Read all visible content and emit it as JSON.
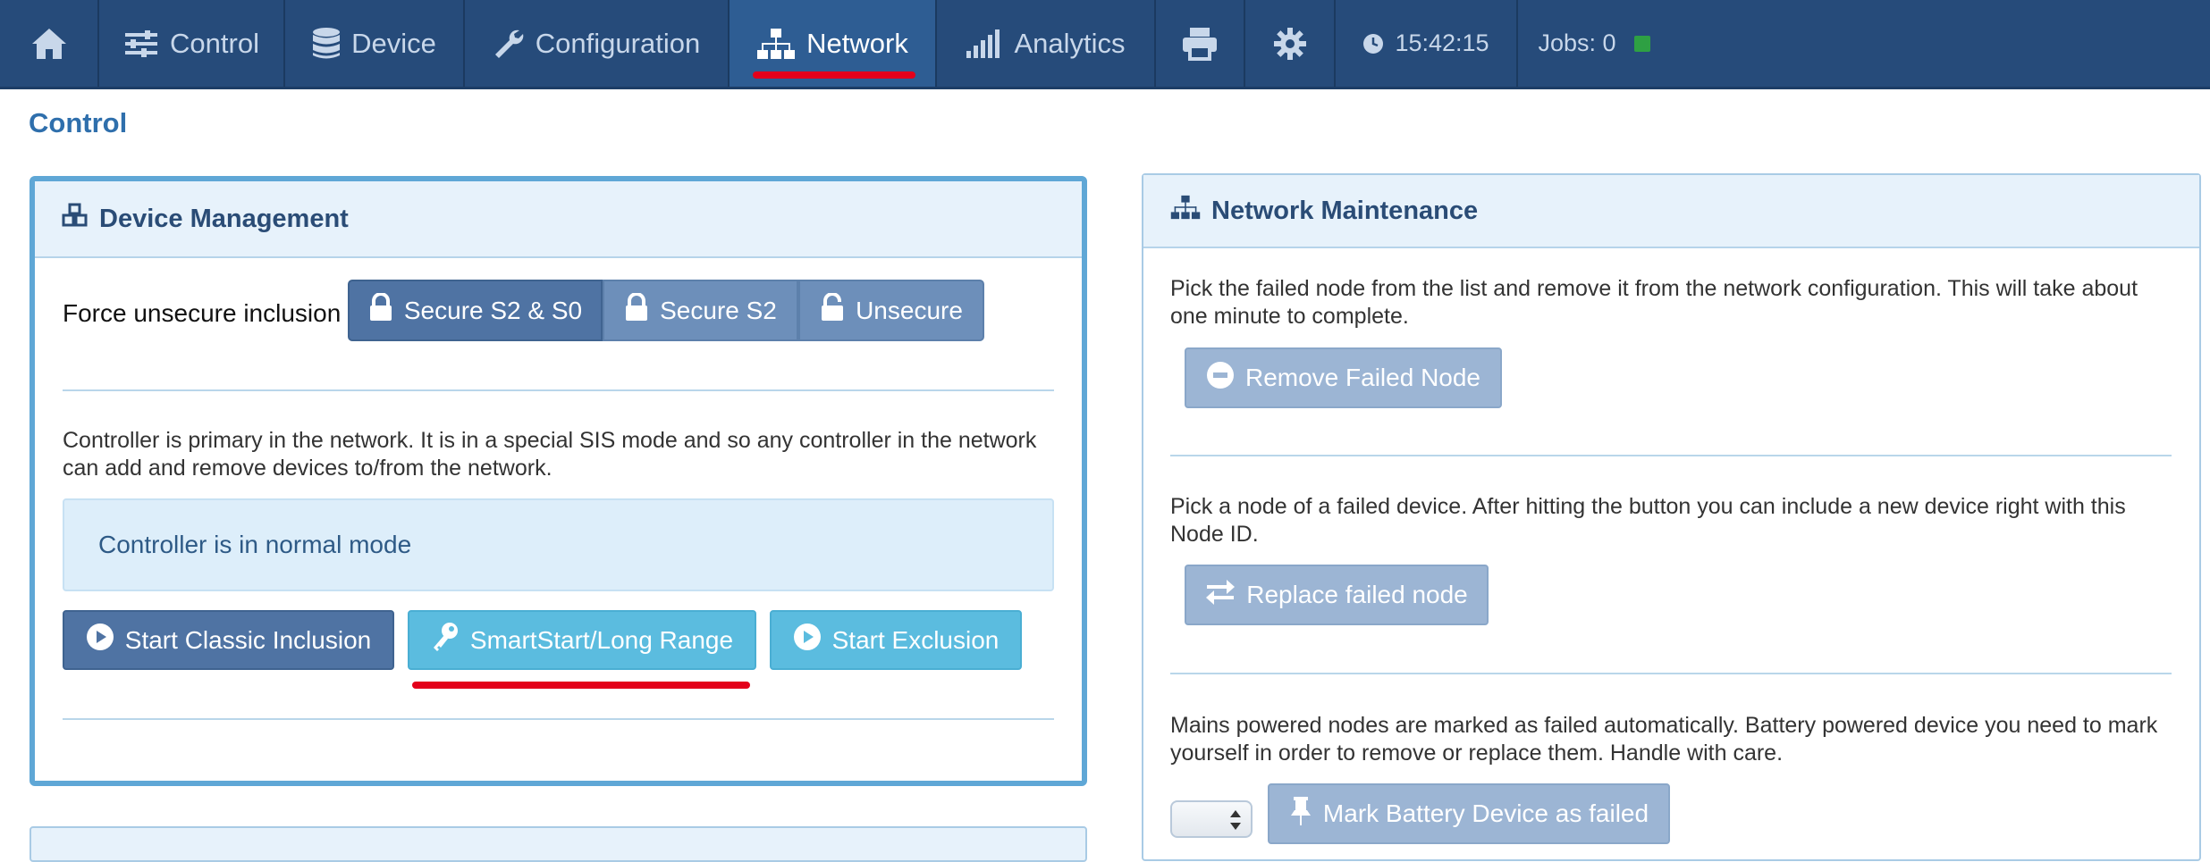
{
  "nav": {
    "home_icon": "home-icon",
    "items": [
      {
        "label": "Control",
        "icon": "sliders-icon"
      },
      {
        "label": "Device",
        "icon": "database-icon"
      },
      {
        "label": "Configuration",
        "icon": "wrench-icon"
      },
      {
        "label": "Network",
        "icon": "sitemap-icon",
        "active": true
      },
      {
        "label": "Analytics",
        "icon": "signal-bars-icon"
      }
    ],
    "print_icon": "printer-icon",
    "settings_icon": "gear-icon",
    "clock": "15:42:15",
    "jobs": "Jobs: 0"
  },
  "page": {
    "title": "Control"
  },
  "device_management": {
    "heading": "Device Management",
    "force_label": "Force unsecure inclusion",
    "security_buttons": [
      "Secure S2 & S0",
      "Secure S2",
      "Unsecure"
    ],
    "description": "Controller is primary in the network. It is in a special SIS mode and so any controller in the network can add and remove devices to/from the network.",
    "status": "Controller is in normal mode",
    "actions": {
      "classic": "Start Classic Inclusion",
      "smartstart": "SmartStart/Long Range",
      "exclusion": "Start Exclusion"
    }
  },
  "network_maintenance": {
    "heading": "Network Maintenance",
    "remove_text": "Pick the failed node from the list and remove it from the network configuration. This will take about one minute to complete.",
    "remove_button": "Remove Failed Node",
    "replace_text": "Pick a node of a failed device. After hitting the button you can include a new device right with this Node ID.",
    "replace_button": "Replace failed node",
    "battery_text": "Mains powered nodes are marked as failed automatically. Battery powered device you need to mark yourself in order to remove or replace them. Handle with care.",
    "battery_button": "Mark Battery Device as failed"
  },
  "colors": {
    "nav_bg": "#264b7a",
    "nav_active": "#2e5d93",
    "accent_red": "#e3001b",
    "jobs_led": "#2ea043"
  }
}
